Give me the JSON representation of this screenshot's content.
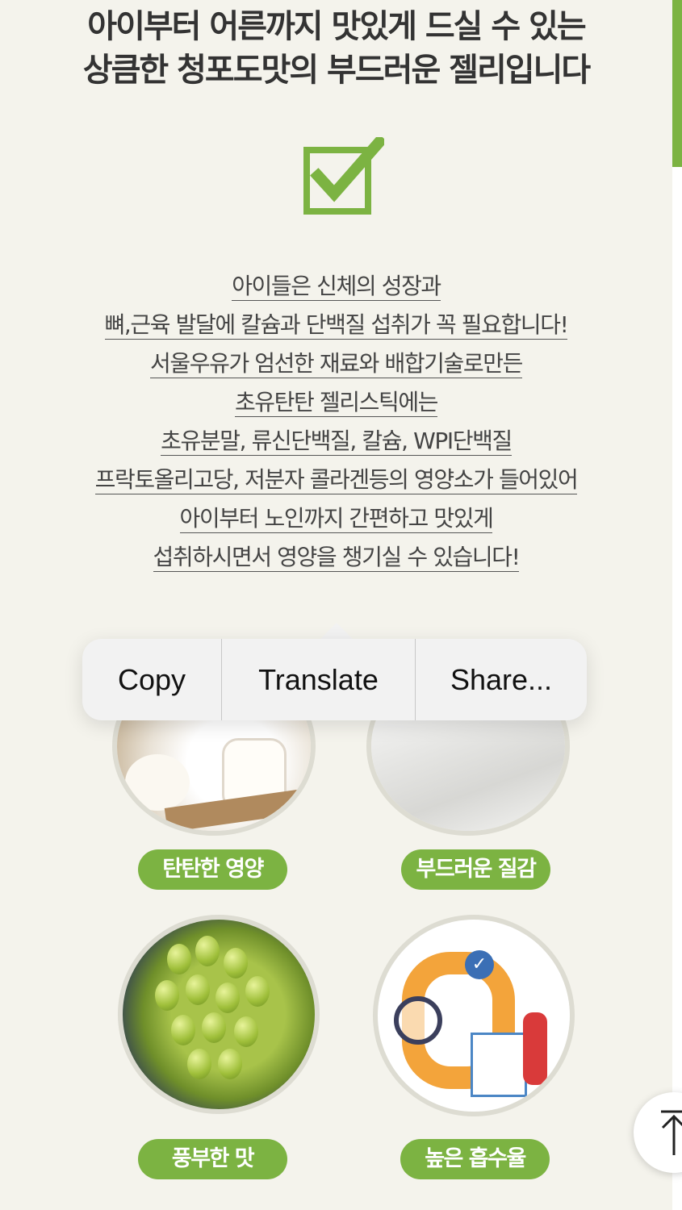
{
  "headline": {
    "line1": "아이부터 어른까지 맛있게 드실 수 있는",
    "line2": "상큼한 청포도맛의 부드러운 젤리입니다"
  },
  "icons": {
    "check": "checkbox-check-icon",
    "scroll_top": "arrow-up-icon"
  },
  "description": [
    "아이들은 신체의 성장과",
    "뼈,근육 발달에 칼슘과 단백질 섭취가 꼭 필요합니다!",
    "서울우유가 엄선한 재료와 배합기술로만든",
    "초유탄탄 젤리스틱에는",
    "초유분말, 류신단백질, 칼슘, WPI단백질",
    "프락토올리고당, 저분자 콜라겐등의 영양소가 들어있어",
    "아이부터 노인까지 간편하고 맛있게",
    "섭취하시면서 영양을 챙기실 수 있습니다!"
  ],
  "features": [
    {
      "label": "탄탄한 영양"
    },
    {
      "label": "부드러운 질감"
    },
    {
      "label": "풍부한 맛"
    },
    {
      "label": "높은 흡수율"
    }
  ],
  "context_menu": {
    "copy": "Copy",
    "translate": "Translate",
    "share": "Share..."
  },
  "colors": {
    "accent_green": "#7cb342",
    "background": "#f4f3ec"
  }
}
